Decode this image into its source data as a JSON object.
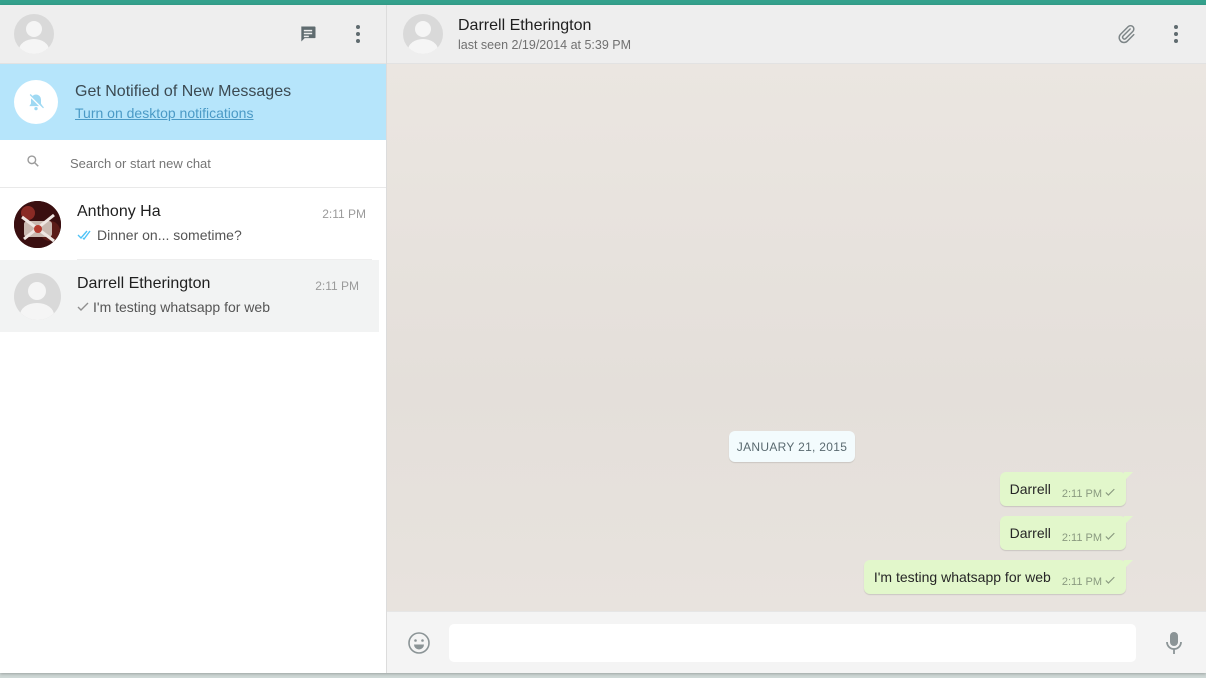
{
  "left": {
    "notification": {
      "title": "Get Notified of New Messages",
      "link": "Turn on desktop notifications"
    },
    "search": {
      "placeholder": "Search or start new chat"
    },
    "chats": [
      {
        "name": "Anthony Ha",
        "time": "2:11 PM",
        "preview": "Dinner on... sometime?",
        "ticks": "double-check-blue"
      },
      {
        "name": "Darrell Etherington",
        "time": "2:11 PM",
        "preview": "I'm testing whatsapp for web",
        "ticks": "single-check"
      }
    ]
  },
  "conversation": {
    "contact_name": "Darrell Etherington",
    "last_seen": "last seen 2/19/2014 at 5:39 PM",
    "date_label": "JANUARY 21, 2015",
    "messages": [
      {
        "text": "Darrell",
        "time": "2:11 PM"
      },
      {
        "text": "Darrell",
        "time": "2:11 PM"
      },
      {
        "text": "I'm testing whatsapp for web",
        "time": "2:11 PM"
      }
    ]
  },
  "composer": {
    "placeholder": ""
  },
  "colors": {
    "accent_top": "#34a18c",
    "notification_bg": "#b6e5fb",
    "bubble_out": "#e2f7cb",
    "chat_bg": "#e9e4df",
    "tick_blue": "#4fc3f7"
  },
  "icons": {
    "header": [
      "new-chat-icon",
      "menu-dots-icon"
    ],
    "conversation": [
      "attach-icon",
      "menu-dots-icon"
    ],
    "composer": [
      "emoji-icon",
      "mic-icon"
    ]
  }
}
